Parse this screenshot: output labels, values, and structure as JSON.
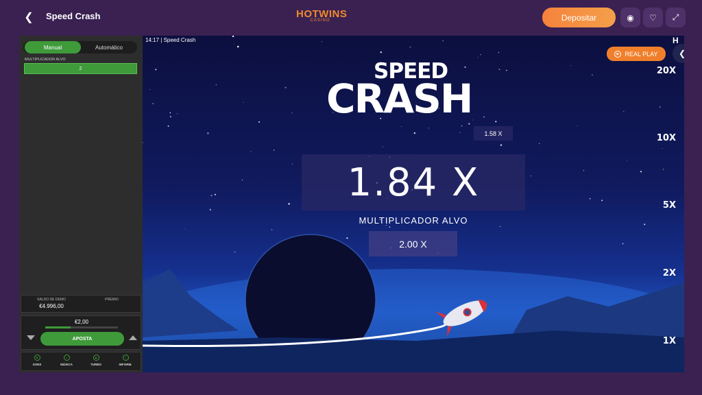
{
  "header": {
    "back_icon": "chevron-left-icon",
    "title": "Speed Crash",
    "logo_main": "HOTWINS",
    "logo_sub": "CASINO",
    "deposit_label": "Depositar",
    "icons": [
      "chat-icon",
      "heart-icon",
      "fullscreen-icon"
    ]
  },
  "panel": {
    "tabs": [
      {
        "label": "Manual"
      },
      {
        "label": "Automático"
      }
    ],
    "target_label": "MULTIPLICADOR ALVO",
    "target_value": "2",
    "balance_label": "SALDO DE DEMO",
    "balance_value": "€4.996,00",
    "prize_label": "PREMIO",
    "prize_value": "",
    "bet_amount": "€2,00",
    "bet_fill": 0.35,
    "bet_button": "APOSTA",
    "footer": [
      {
        "label": "SONS",
        "icon": "sound-icon"
      },
      {
        "label": "MÚSICA",
        "icon": "music-icon"
      },
      {
        "label": "TURBO",
        "icon": "turbo-icon"
      },
      {
        "label": "INFORM.",
        "icon": "info-icon"
      }
    ]
  },
  "game": {
    "time": "14:17",
    "name": "| Speed Crash",
    "logo_top": "SPEED",
    "logo_bottom": "CRASH",
    "previous_multiplier": "1.58 X",
    "current_multiplier": "1.84 X",
    "target_label": "MULTIPLICADOR ALVO",
    "target_value": "2.00 X",
    "real_play": "REAL PLAY",
    "scale": [
      "20X",
      "10X",
      "5X",
      "2X",
      "1X"
    ],
    "h_mark": "H"
  },
  "colors": {
    "accent_green": "#3f9a3a",
    "accent_orange": "#f07f2c",
    "background": "#3a2152"
  }
}
